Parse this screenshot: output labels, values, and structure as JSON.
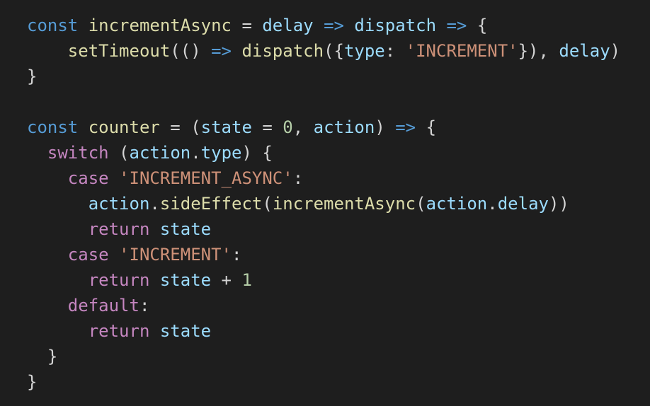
{
  "editor": {
    "background": "#1e1e1e",
    "token_colors": {
      "kw": "#569cd6",
      "ctrl": "#c586c0",
      "fn": "#dcdcaa",
      "var": "#9cdcfe",
      "str": "#ce9178",
      "num": "#b5cea8",
      "plain": "#d4d4d4"
    },
    "lines": [
      {
        "tokens": [
          {
            "t": "kw",
            "v": "const"
          },
          {
            "t": "plain",
            "v": " "
          },
          {
            "t": "fn",
            "v": "incrementAsync"
          },
          {
            "t": "plain",
            "v": " = "
          },
          {
            "t": "var",
            "v": "delay"
          },
          {
            "t": "plain",
            "v": " "
          },
          {
            "t": "kw",
            "v": "=>"
          },
          {
            "t": "plain",
            "v": " "
          },
          {
            "t": "var",
            "v": "dispatch"
          },
          {
            "t": "plain",
            "v": " "
          },
          {
            "t": "kw",
            "v": "=>"
          },
          {
            "t": "plain",
            "v": " {"
          }
        ]
      },
      {
        "tokens": [
          {
            "t": "plain",
            "v": "    "
          },
          {
            "t": "fn",
            "v": "setTimeout"
          },
          {
            "t": "plain",
            "v": "(() "
          },
          {
            "t": "kw",
            "v": "=>"
          },
          {
            "t": "plain",
            "v": " "
          },
          {
            "t": "fn",
            "v": "dispatch"
          },
          {
            "t": "plain",
            "v": "({"
          },
          {
            "t": "var",
            "v": "type"
          },
          {
            "t": "plain",
            "v": ": "
          },
          {
            "t": "str",
            "v": "'INCREMENT'"
          },
          {
            "t": "plain",
            "v": "}), "
          },
          {
            "t": "var",
            "v": "delay"
          },
          {
            "t": "plain",
            "v": ")"
          }
        ]
      },
      {
        "tokens": [
          {
            "t": "plain",
            "v": "}"
          }
        ]
      },
      {
        "tokens": []
      },
      {
        "tokens": [
          {
            "t": "kw",
            "v": "const"
          },
          {
            "t": "plain",
            "v": " "
          },
          {
            "t": "fn",
            "v": "counter"
          },
          {
            "t": "plain",
            "v": " = ("
          },
          {
            "t": "var",
            "v": "state"
          },
          {
            "t": "plain",
            "v": " = "
          },
          {
            "t": "num",
            "v": "0"
          },
          {
            "t": "plain",
            "v": ", "
          },
          {
            "t": "var",
            "v": "action"
          },
          {
            "t": "plain",
            "v": ") "
          },
          {
            "t": "kw",
            "v": "=>"
          },
          {
            "t": "plain",
            "v": " {"
          }
        ]
      },
      {
        "tokens": [
          {
            "t": "plain",
            "v": "  "
          },
          {
            "t": "ctrl",
            "v": "switch"
          },
          {
            "t": "plain",
            "v": " ("
          },
          {
            "t": "var",
            "v": "action"
          },
          {
            "t": "plain",
            "v": "."
          },
          {
            "t": "var",
            "v": "type"
          },
          {
            "t": "plain",
            "v": ") {"
          }
        ]
      },
      {
        "tokens": [
          {
            "t": "plain",
            "v": "    "
          },
          {
            "t": "ctrl",
            "v": "case"
          },
          {
            "t": "plain",
            "v": " "
          },
          {
            "t": "str",
            "v": "'INCREMENT_ASYNC'"
          },
          {
            "t": "plain",
            "v": ":"
          }
        ]
      },
      {
        "tokens": [
          {
            "t": "plain",
            "v": "      "
          },
          {
            "t": "var",
            "v": "action"
          },
          {
            "t": "plain",
            "v": "."
          },
          {
            "t": "fn",
            "v": "sideEffect"
          },
          {
            "t": "plain",
            "v": "("
          },
          {
            "t": "fn",
            "v": "incrementAsync"
          },
          {
            "t": "plain",
            "v": "("
          },
          {
            "t": "var",
            "v": "action"
          },
          {
            "t": "plain",
            "v": "."
          },
          {
            "t": "var",
            "v": "delay"
          },
          {
            "t": "plain",
            "v": "))"
          }
        ]
      },
      {
        "tokens": [
          {
            "t": "plain",
            "v": "      "
          },
          {
            "t": "ctrl",
            "v": "return"
          },
          {
            "t": "plain",
            "v": " "
          },
          {
            "t": "var",
            "v": "state"
          }
        ]
      },
      {
        "tokens": [
          {
            "t": "plain",
            "v": "    "
          },
          {
            "t": "ctrl",
            "v": "case"
          },
          {
            "t": "plain",
            "v": " "
          },
          {
            "t": "str",
            "v": "'INCREMENT'"
          },
          {
            "t": "plain",
            "v": ":"
          }
        ]
      },
      {
        "tokens": [
          {
            "t": "plain",
            "v": "      "
          },
          {
            "t": "ctrl",
            "v": "return"
          },
          {
            "t": "plain",
            "v": " "
          },
          {
            "t": "var",
            "v": "state"
          },
          {
            "t": "plain",
            "v": " + "
          },
          {
            "t": "num",
            "v": "1"
          }
        ]
      },
      {
        "tokens": [
          {
            "t": "plain",
            "v": "    "
          },
          {
            "t": "ctrl",
            "v": "default"
          },
          {
            "t": "plain",
            "v": ":"
          }
        ]
      },
      {
        "tokens": [
          {
            "t": "plain",
            "v": "      "
          },
          {
            "t": "ctrl",
            "v": "return"
          },
          {
            "t": "plain",
            "v": " "
          },
          {
            "t": "var",
            "v": "state"
          }
        ]
      },
      {
        "tokens": [
          {
            "t": "plain",
            "v": "  }"
          }
        ]
      },
      {
        "tokens": [
          {
            "t": "plain",
            "v": "}"
          }
        ]
      }
    ]
  }
}
